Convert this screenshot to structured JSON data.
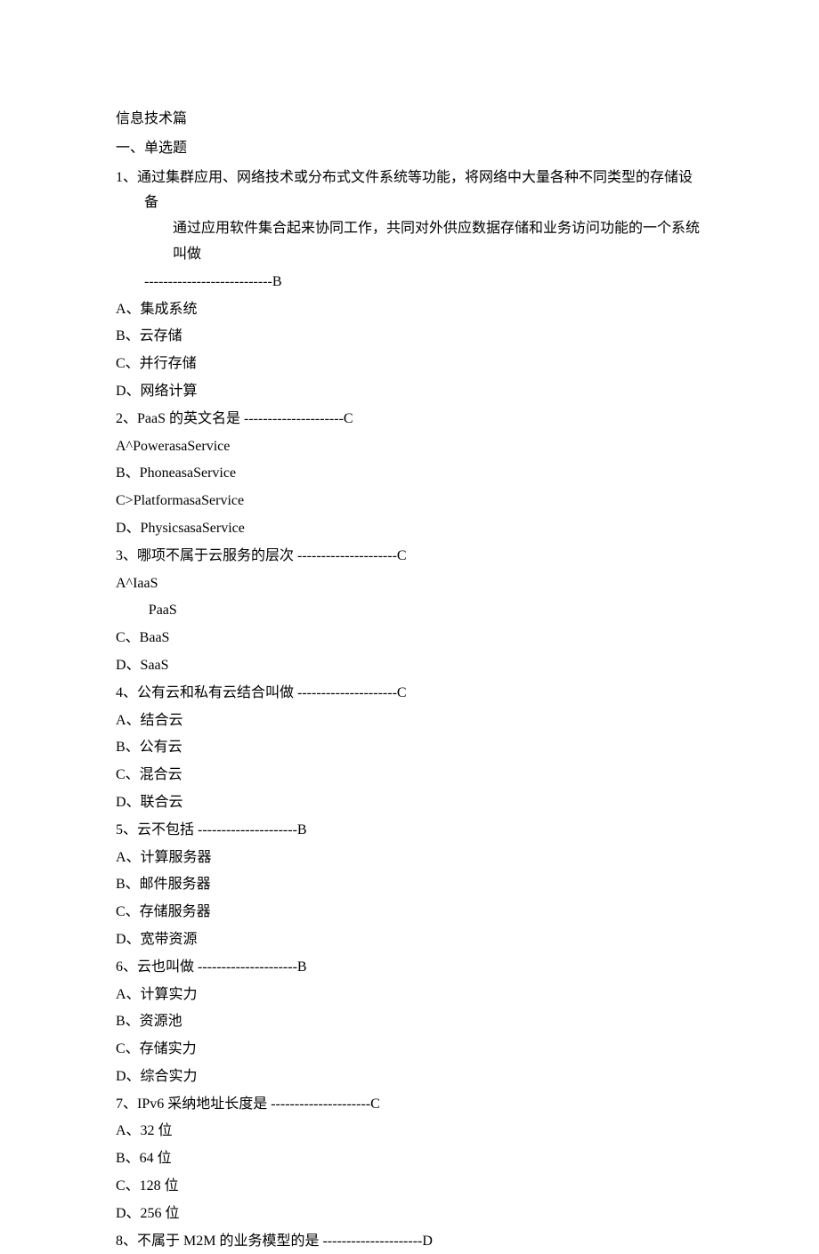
{
  "title": "信息技术篇",
  "section": "一、单选题",
  "q1": {
    "stem_l1": "1、通过集群应用、网络技术或分布式文件系统等功能，将网络中大量各种不同类型的存储设备",
    "stem_l2": "通过应用软件集合起来协同工作，共同对外供应数据存储和业务访问功能的一个系统叫做",
    "ans": "---------------------------B",
    "a": "A、集成系统",
    "b": "B、云存储",
    "c": "C、并行存储",
    "d": "D、网络计算"
  },
  "q2": {
    "stem": "2、PaaS 的英文名是 ---------------------C",
    "a": "A^PowerasaService",
    "b": "B、PhoneasaService",
    "c": "C>PlatformasaService",
    "d": "D、PhysicsasaService"
  },
  "q3": {
    "stem": "3、哪项不属于云服务的层次 ---------------------C",
    "a": "A^IaaS",
    "b": "PaaS",
    "c": "C、BaaS",
    "d": "D、SaaS"
  },
  "q4": {
    "stem": "4、公有云和私有云结合叫做 ---------------------C",
    "a": "A、结合云",
    "b": "B、公有云",
    "c": "C、混合云",
    "d": "D、联合云"
  },
  "q5": {
    "stem": "5、云不包括 ---------------------B",
    "a": "A、计算服务器",
    "b": "B、邮件服务器",
    "c": "C、存储服务器",
    "d": "D、宽带资源"
  },
  "q6": {
    "stem": "6、云也叫做 ---------------------B",
    "a": "A、计算实力",
    "b": "B、资源池",
    "c": "C、存储实力",
    "d": "D、综合实力"
  },
  "q7": {
    "stem": "7、IPv6 采纳地址长度是 ---------------------C",
    "a": "A、32 位",
    "b": "B、64 位",
    "c": "C、128 位",
    "d": "D、256 位"
  },
  "q8": {
    "stem": "8、不属于 M2M 的业务模型的是 ---------------------D"
  }
}
